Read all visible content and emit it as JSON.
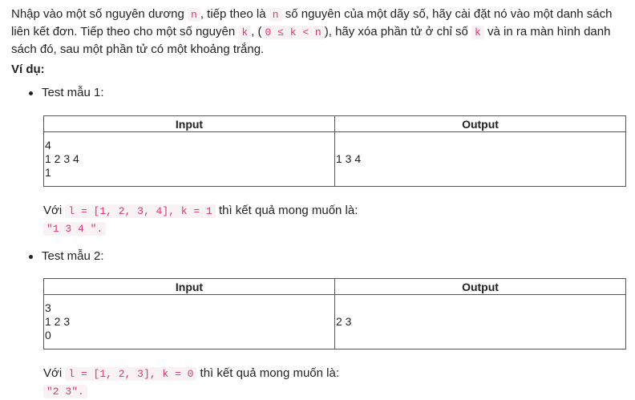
{
  "intro": {
    "p1": "Nhập vào một số nguyên dương ",
    "n1": "n",
    "p2": ", tiếp theo là ",
    "n2": "n",
    "p3": " số nguyên của một dãy số, hãy cài đặt nó vào một danh sách liên kết đơn. Tiếp theo cho một số nguyên ",
    "k1": "k",
    "p4": ", (",
    "cond": "0 ≤ k < n",
    "p5": "), hãy xóa phần tử ở chỉ số ",
    "k2": "k",
    "p6": " và in ra màn hình danh sách đó, sau một phần tử có một khoảng trắng."
  },
  "example_label": "Ví dụ:",
  "tests": [
    {
      "title": "Test mẫu 1:",
      "headers": [
        "Input",
        "Output"
      ],
      "input": [
        "4",
        "1 2 3 4",
        "1"
      ],
      "output": "1 3 4",
      "note_prefix": "Với ",
      "note_code": "l = [1, 2, 3, 4], k = 1",
      "note_suffix": " thì kết quả mong muốn là:",
      "result": "\"1 3 4 \"."
    },
    {
      "title": "Test mẫu 2:",
      "headers": [
        "Input",
        "Output"
      ],
      "input": [
        "3",
        "1 2 3",
        "0"
      ],
      "output": "2 3",
      "note_prefix": "Với ",
      "note_code": "l = [1, 2, 3], k = 0",
      "note_suffix": " thì kết quả mong muốn là:",
      "result": "\"2 3\"."
    }
  ]
}
